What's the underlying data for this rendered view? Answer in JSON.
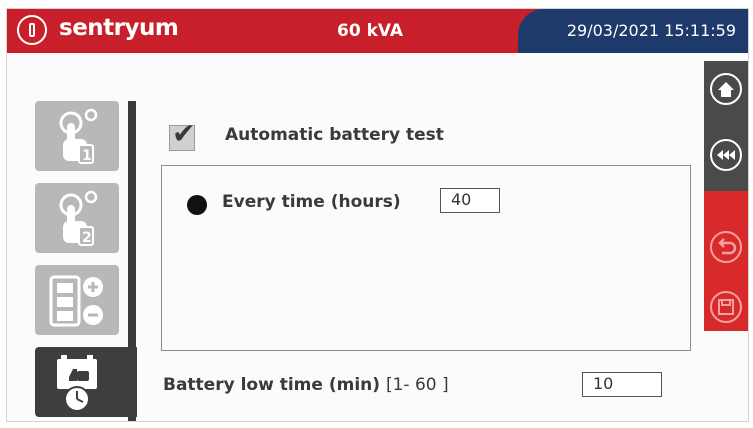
{
  "header": {
    "brand": "sentryum",
    "power": "60 kVA",
    "datetime": "29/03/2021 15:11:59",
    "colors": {
      "brand_red": "#c8202b",
      "header_blue": "#1e3a6b"
    }
  },
  "sidebar": {
    "items": [
      {
        "icon": "hand-touch-1-icon",
        "active": false
      },
      {
        "icon": "hand-touch-2-icon",
        "active": false
      },
      {
        "icon": "battery-plus-minus-icon",
        "active": false
      },
      {
        "icon": "battery-clock-thumb-icon",
        "active": true
      }
    ]
  },
  "right_toolbar": {
    "buttons": [
      {
        "icon": "home-icon"
      },
      {
        "icon": "rewind-icon"
      },
      {
        "icon": "undo-icon"
      },
      {
        "icon": "save-icon"
      }
    ]
  },
  "settings": {
    "auto_test_label": "Automatic battery test",
    "auto_test_checked": true,
    "every_time_label": "Every  time (hours)",
    "every_time_value": "40",
    "battery_low_label": "Battery low time (min)",
    "battery_low_range": "[1- 60 ]",
    "battery_low_value": "10"
  }
}
